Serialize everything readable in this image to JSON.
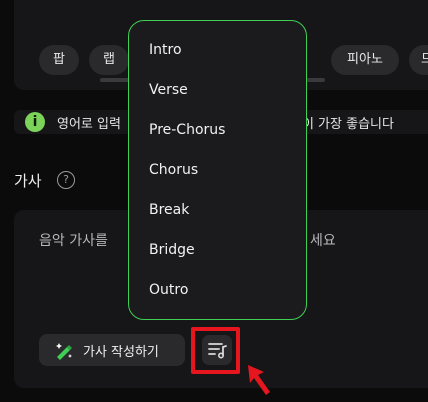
{
  "genre_chips": [
    "팝",
    "랩",
    "피아노",
    "드"
  ],
  "info": {
    "text_left": "영어로 입력",
    "text_right": "질이 가장 좋습니다"
  },
  "lyrics": {
    "label": "가사",
    "placeholder_left": "음악 가사를",
    "placeholder_right": "세요",
    "write_button_label": "가사 작성하기"
  },
  "structure_menu": {
    "items": [
      "Intro",
      "Verse",
      "Pre-Chorus",
      "Chorus",
      "Break",
      "Bridge",
      "Outro"
    ]
  },
  "colors": {
    "menu_border": "#3fcf54",
    "highlight": "#e5161d",
    "info_icon": "#7bd35a"
  }
}
